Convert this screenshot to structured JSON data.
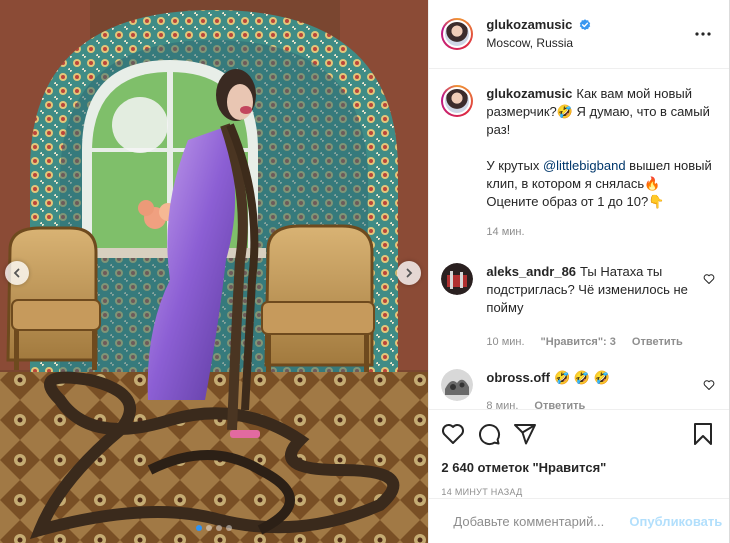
{
  "post": {
    "author": "glukozamusic",
    "location": "Moscow, Russia",
    "media": {
      "slide_count": 4,
      "active_slide": 1,
      "prev_icon": "chevron-left-icon",
      "next_icon": "chevron-right-icon"
    }
  },
  "caption": {
    "username": "glukozamusic",
    "line1": "Как вам мой новый размерчик?🤣 Я думаю, что в самый раз!",
    "line2_prefix": "У крутых ",
    "line2_mention": "@littlebigband",
    "line2_suffix": " вышел новый клип, в котором я снялась🔥 Оцените образ от 1 до 10?👇",
    "time": "14 мин."
  },
  "comments": [
    {
      "username": "aleks_andr_86",
      "text": "Ты Натаха ты подстриглась? Чё изменилось не пойму",
      "time": "10 мин.",
      "likes_label": "\"Нравится\": 3",
      "reply_label": "Ответить"
    },
    {
      "username": "obross.off",
      "text": "🤣 🤣 🤣",
      "time": "8 мин.",
      "reply_label": "Ответить"
    }
  ],
  "actions": {
    "likes_text": "2 640 отметок \"Нравится\"",
    "time_ago": "14 МИНУТ НАЗАД"
  },
  "add_comment": {
    "placeholder": "Добавьте комментарий...",
    "publish_label": "Опубликовать"
  },
  "colors": {
    "verified": "#3897f0",
    "link": "#00376b",
    "publish_disabled": "#b2dffc",
    "active_dot": "#2f94f5"
  }
}
